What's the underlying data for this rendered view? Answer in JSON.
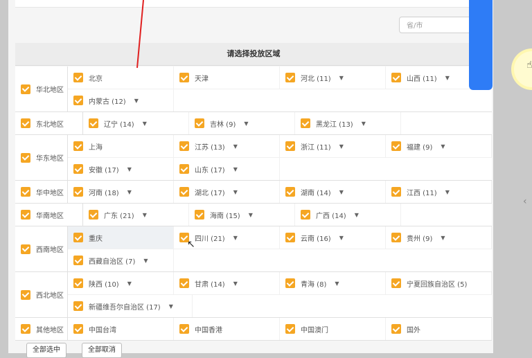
{
  "search": {
    "placeholder": "省/市"
  },
  "title": "请选择投放区域",
  "regions": [
    {
      "label": "华北地区",
      "rows": [
        [
          {
            "label": "北京"
          },
          {
            "label": "天津"
          },
          {
            "label": "河北 (11)",
            "dropdown": true
          },
          {
            "label": "山西 (11)",
            "dropdown": true
          }
        ],
        [
          {
            "label": "内蒙古 (12)",
            "dropdown": true
          }
        ]
      ]
    },
    {
      "label": "东北地区",
      "rows": [
        [
          {
            "label": "辽宁 (14)",
            "dropdown": true
          },
          {
            "label": "吉林 (9)",
            "dropdown": true
          },
          {
            "label": "黑龙江 (13)",
            "dropdown": true
          }
        ]
      ]
    },
    {
      "label": "华东地区",
      "rows": [
        [
          {
            "label": "上海"
          },
          {
            "label": "江苏 (13)",
            "dropdown": true
          },
          {
            "label": "浙江 (11)",
            "dropdown": true
          },
          {
            "label": "福建 (9)",
            "dropdown": true
          }
        ],
        [
          {
            "label": "安徽 (17)",
            "dropdown": true
          },
          {
            "label": "山东 (17)",
            "dropdown": true
          }
        ]
      ]
    },
    {
      "label": "华中地区",
      "rows": [
        [
          {
            "label": "河南 (18)",
            "dropdown": true
          },
          {
            "label": "湖北 (17)",
            "dropdown": true
          },
          {
            "label": "湖南 (14)",
            "dropdown": true
          },
          {
            "label": "江西 (11)",
            "dropdown": true
          }
        ]
      ]
    },
    {
      "label": "华南地区",
      "rows": [
        [
          {
            "label": "广东 (21)",
            "dropdown": true
          },
          {
            "label": "海南 (15)",
            "dropdown": true
          },
          {
            "label": "广西 (14)",
            "dropdown": true
          }
        ]
      ]
    },
    {
      "label": "西南地区",
      "rows": [
        [
          {
            "label": "重庆",
            "highlight": true
          },
          {
            "label": "四川 (21)",
            "dropdown": true
          },
          {
            "label": "云南 (16)",
            "dropdown": true
          },
          {
            "label": "贵州 (9)",
            "dropdown": true
          }
        ],
        [
          {
            "label": "西藏自治区 (7)",
            "dropdown": true
          }
        ]
      ]
    },
    {
      "label": "西北地区",
      "rows": [
        [
          {
            "label": "陕西 (10)",
            "dropdown": true
          },
          {
            "label": "甘肃 (14)",
            "dropdown": true
          },
          {
            "label": "青海 (8)",
            "dropdown": true
          },
          {
            "label": "宁夏回族自治区 (5)"
          }
        ],
        [
          {
            "label": "新疆维吾尔自治区 (17)",
            "dropdown": true
          }
        ]
      ]
    },
    {
      "label": "其他地区",
      "rows": [
        [
          {
            "label": "中国台湾"
          },
          {
            "label": "中国香港"
          },
          {
            "label": "中国澳门"
          },
          {
            "label": "国外"
          }
        ]
      ]
    }
  ],
  "buttons": {
    "select_all": "全部选中",
    "cancel_all": "全部取消"
  },
  "colors": {
    "checkbox": "#f5a623",
    "accent": "#2e7cf6"
  }
}
